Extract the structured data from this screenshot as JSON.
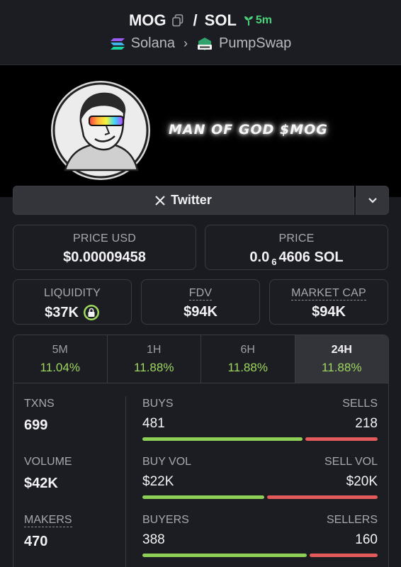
{
  "header": {
    "base_token": "MOG",
    "separator": "/",
    "quote_token": "SOL",
    "age": "5m",
    "chain": "Solana",
    "dex": "PumpSwap"
  },
  "banner": {
    "tagline": "MAN OF GOD $MOG"
  },
  "links": {
    "twitter_label": "Twitter"
  },
  "price_cards": {
    "price_usd_label": "PRICE USD",
    "price_usd_value": "$0.00009458",
    "price_label": "PRICE",
    "price_prefix": "0.0",
    "price_zeros": "6",
    "price_suffix": "4606 SOL"
  },
  "metric_cards": {
    "liquidity_label": "LIQUIDITY",
    "liquidity_value": "$37K",
    "fdv_label": "FDV",
    "fdv_value": "$94K",
    "mcap_label": "MARKET CAP",
    "mcap_value": "$94K"
  },
  "tabs": [
    {
      "label": "5M",
      "value": "11.04%",
      "active": false
    },
    {
      "label": "1H",
      "value": "11.88%",
      "active": false
    },
    {
      "label": "6H",
      "value": "11.88%",
      "active": false
    },
    {
      "label": "24H",
      "value": "11.88%",
      "active": true
    }
  ],
  "stats": {
    "txns_label": "TXNS",
    "txns_value": "699",
    "volume_label": "VOLUME",
    "volume_value": "$42K",
    "makers_label": "MAKERS",
    "makers_value": "470",
    "buys_label": "BUYS",
    "buys_value": "481",
    "sells_label": "SELLS",
    "sells_value": "218",
    "buy_vol_label": "BUY VOL",
    "buy_vol_value": "$22K",
    "sell_vol_label": "SELL VOL",
    "sell_vol_value": "$20K",
    "buyers_label": "BUYERS",
    "buyers_value": "388",
    "sellers_label": "SELLERS",
    "sellers_value": "160",
    "buy_ratio_txns": 0.688,
    "buy_ratio_volume": 0.524,
    "buy_ratio_makers": 0.708
  },
  "colors": {
    "up": "#9fd85f",
    "buy_bar": "#8ecf58",
    "sell_bar": "#e35a5a",
    "age": "#4bd37b"
  }
}
